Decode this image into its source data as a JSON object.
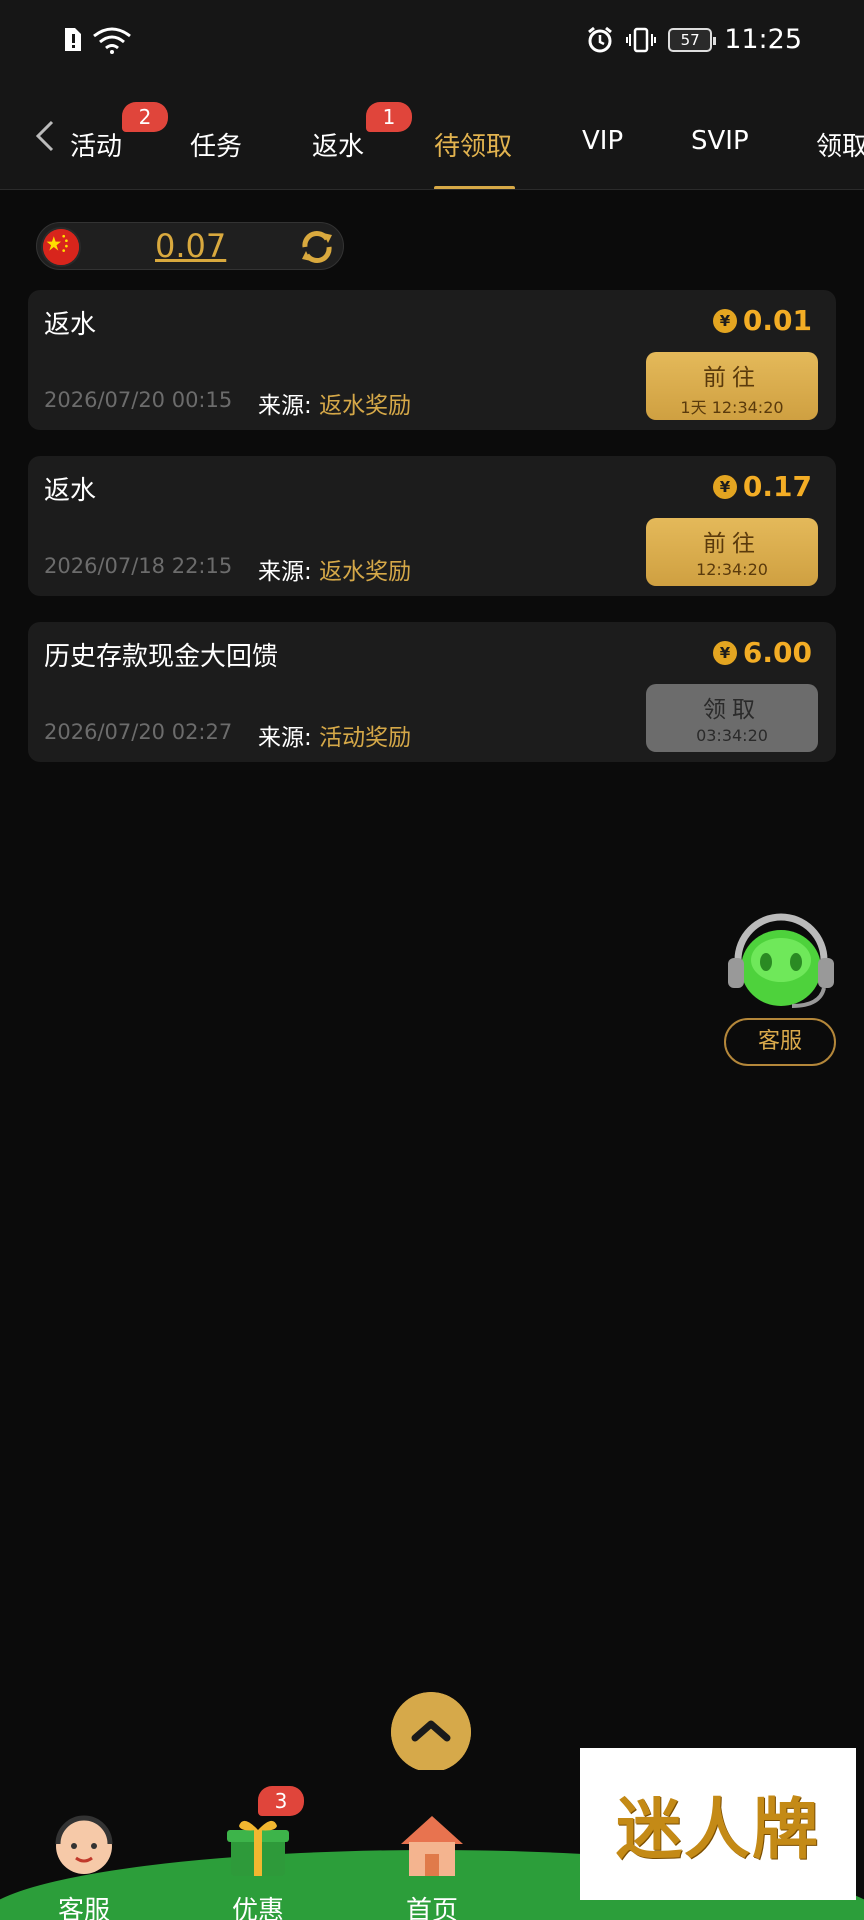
{
  "status_bar": {
    "time": "11:25",
    "battery": "57"
  },
  "tabs": [
    {
      "label": "活动",
      "badge": "2"
    },
    {
      "label": "任务",
      "badge": ""
    },
    {
      "label": "返水",
      "badge": "1"
    },
    {
      "label": "待领取",
      "badge": ""
    },
    {
      "label": "VIP",
      "badge": ""
    },
    {
      "label": "SVIP",
      "badge": ""
    },
    {
      "label": "领取",
      "badge": ""
    }
  ],
  "active_tab": "待领取",
  "balance": {
    "value": "0.07"
  },
  "colors": {
    "accent": "#d7a947",
    "amount": "#f3ad25",
    "badge": "#e0453b",
    "background": "#0b0b0b"
  },
  "cards": [
    {
      "title": "返水",
      "amount": "0.01",
      "date": "2026/07/20 00:15",
      "source_label": "来源:",
      "source": "返水奖励",
      "button_label": "前往",
      "button_sub": "1天 12:34:20",
      "button_state": "active"
    },
    {
      "title": "返水",
      "amount": "0.17",
      "date": "2026/07/18 22:15",
      "source_label": "来源:",
      "source": "返水奖励",
      "button_label": "前往",
      "button_sub": "12:34:20",
      "button_state": "active"
    },
    {
      "title": "历史存款现金大回馈",
      "amount": "6.00",
      "date": "2026/07/20 02:27",
      "source_label": "来源:",
      "source": "活动奖励",
      "button_label": "领取",
      "button_sub": "03:34:20",
      "button_state": "disabled"
    }
  ],
  "currency_symbol": "¥",
  "customer_service": {
    "label": "客服"
  },
  "bottom_nav": [
    {
      "label": "客服",
      "icon": "headset-avatar-icon"
    },
    {
      "label": "优惠",
      "icon": "gift-icon",
      "badge": "3"
    },
    {
      "label": "首页",
      "icon": "house-icon"
    }
  ],
  "watermark": "迷人牌"
}
